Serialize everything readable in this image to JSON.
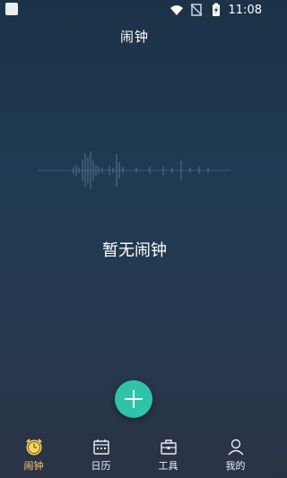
{
  "status": {
    "time": "11:08",
    "battery_level_percent": 100
  },
  "header": {
    "title": "闹钟"
  },
  "empty_state": {
    "text": "暂无闹钟"
  },
  "fab": {
    "icon": "plus-icon",
    "color": "#2fc3a7"
  },
  "nav": {
    "items": [
      {
        "label": "闹钟",
        "icon": "alarm-clock-icon",
        "active": true
      },
      {
        "label": "日历",
        "icon": "calendar-icon",
        "active": false
      },
      {
        "label": "工具",
        "icon": "toolbox-icon",
        "active": false
      },
      {
        "label": "我的",
        "icon": "user-icon",
        "active": false
      }
    ]
  },
  "colors": {
    "accent": "#f6d26a",
    "nav_background": "#2b3446"
  }
}
